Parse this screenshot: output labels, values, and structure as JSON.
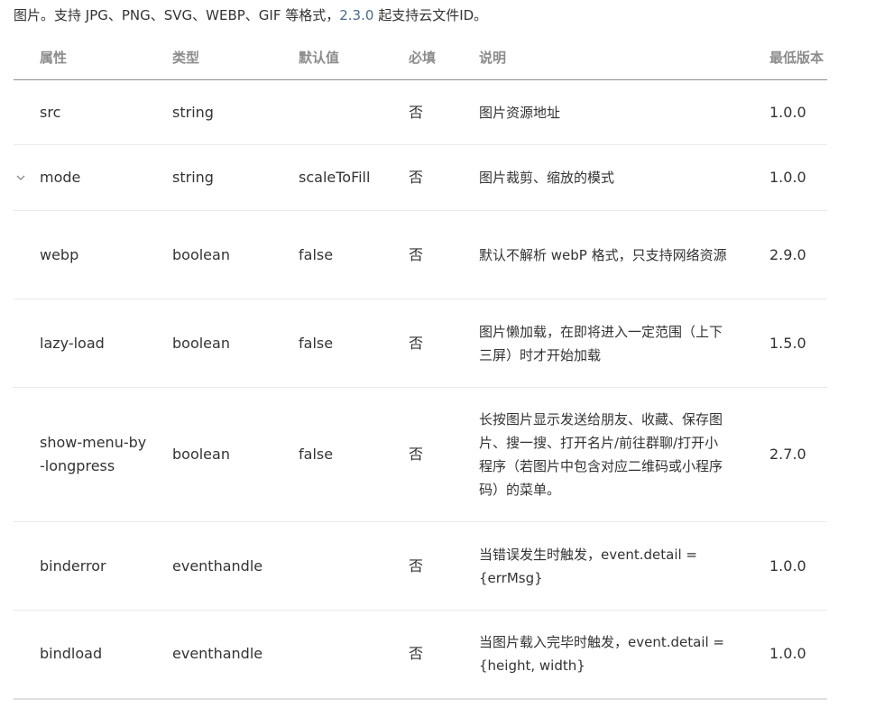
{
  "intro": {
    "text": "图片。支持 JPG、PNG、SVG、WEBP、GIF 等格式，",
    "version_link": "2.3.0",
    "suffix": " 起支持云文件ID。"
  },
  "table": {
    "headers": {
      "name": "属性",
      "type": "类型",
      "default": "默认值",
      "required": "必填",
      "desc": "说明",
      "version": "最低版本"
    },
    "rows": [
      {
        "name": "src",
        "type": "string",
        "default": "",
        "required": "否",
        "desc": "图片资源地址",
        "version": "1.0.0"
      },
      {
        "name": "mode",
        "type": "string",
        "default": "scaleToFill",
        "required": "否",
        "desc": "图片裁剪、缩放的模式",
        "version": "1.0.0"
      },
      {
        "name": "webp",
        "type": "boolean",
        "default": "false",
        "required": "否",
        "desc": "默认不解析 webP 格式，只支持网络资源",
        "version": "2.9.0"
      },
      {
        "name": "lazy-load",
        "type": "boolean",
        "default": "false",
        "required": "否",
        "desc": "图片懒加载，在即将进入一定范围（上下三屏）时才开始加载",
        "version": "1.5.0"
      },
      {
        "name": "show-menu-by-longpress",
        "type": "boolean",
        "default": "false",
        "required": "否",
        "desc": "长按图片显示发送给朋友、收藏、保存图片、搜一搜、打开名片/前往群聊/打开小程序（若图片中包含对应二维码或小程序码）的菜单。",
        "version": "2.7.0"
      },
      {
        "name": "binderror",
        "type": "eventhandle",
        "default": "",
        "required": "否",
        "desc": "当错误发生时触发，event.detail = {errMsg}",
        "version": "1.0.0"
      },
      {
        "name": "bindload",
        "type": "eventhandle",
        "default": "",
        "required": "否",
        "desc": "当图片载入完毕时触发，event.detail = {height, width}",
        "version": "1.0.0"
      }
    ]
  },
  "icons": {
    "expand": "chevron-down-icon"
  },
  "colors": {
    "text": "#333333",
    "header": "#8c8c8c",
    "version": "#4b6a8e",
    "row_border": "#e9e9e9"
  }
}
